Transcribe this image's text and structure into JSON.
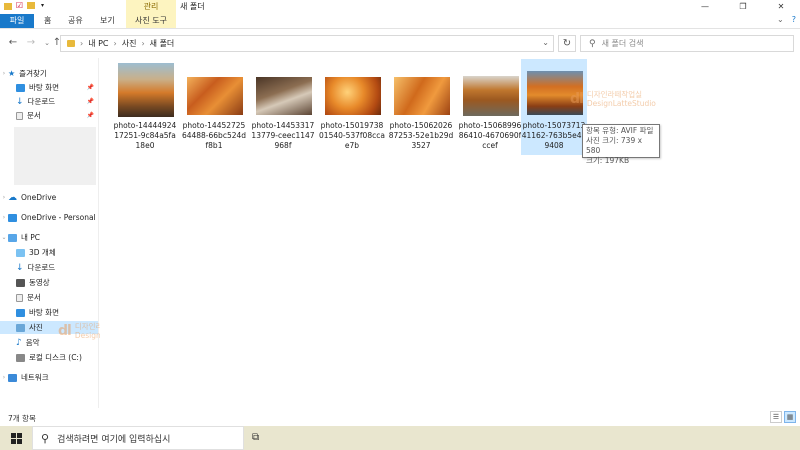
{
  "titlebar": {
    "context_tab": "관리",
    "window_title": "새 폴더",
    "controls": [
      "—",
      "❐",
      "✕"
    ]
  },
  "ribbon": {
    "tabs": [
      "파일",
      "홈",
      "공유",
      "보기",
      "사진 도구"
    ],
    "collapse": "⌄",
    "help": "?"
  },
  "nav": {
    "path": [
      "내 PC",
      "사진",
      "새 폴더"
    ],
    "search_placeholder": "새 폴더 검색"
  },
  "sidebar": {
    "quick_access": "즐겨찾기",
    "quick_items": [
      "바탕 화면",
      "다운로드",
      "문서"
    ],
    "onedrive": "OneDrive",
    "onedrive_personal": "OneDrive - Personal",
    "this_pc": "내 PC",
    "pc_items": [
      "3D 개체",
      "다운로드",
      "동영상",
      "문서",
      "바탕 화면",
      "사진",
      "음악",
      "로컬 디스크 (C:)"
    ],
    "network": "네트워크"
  },
  "files": [
    {
      "name": "photo-1444492417251-9c84a5fa18e0"
    },
    {
      "name": "photo-1445272564488-66bc524df8b1"
    },
    {
      "name": "photo-1445331713779-ceec1147968f"
    },
    {
      "name": "photo-1501973801540-537f08ccae7b"
    },
    {
      "name": "photo-1506202687253-52e1b29d3527"
    },
    {
      "name": "photo-1506899686410-4670690fccef"
    },
    {
      "name": "photo-1507371341162-763b5e419408"
    }
  ],
  "tooltip": {
    "type": "항목 유형: AVIF 파일",
    "dims": "사진 크기: 739 x 580",
    "size": "크기: 197KB"
  },
  "watermark": {
    "logo": "dl",
    "line1": "디자인라떼작업실",
    "line2": "DesignLatteStudio"
  },
  "status": {
    "count": "7개 항목"
  },
  "taskbar": {
    "search_placeholder": "검색하려면 여기에 입력하십시"
  },
  "colors": {
    "accent": "#1979ca",
    "selection": "#cce8ff",
    "context_tab": "#fdf4c0",
    "folder": "#e8b93b",
    "taskbar": "#e9e6cf"
  }
}
